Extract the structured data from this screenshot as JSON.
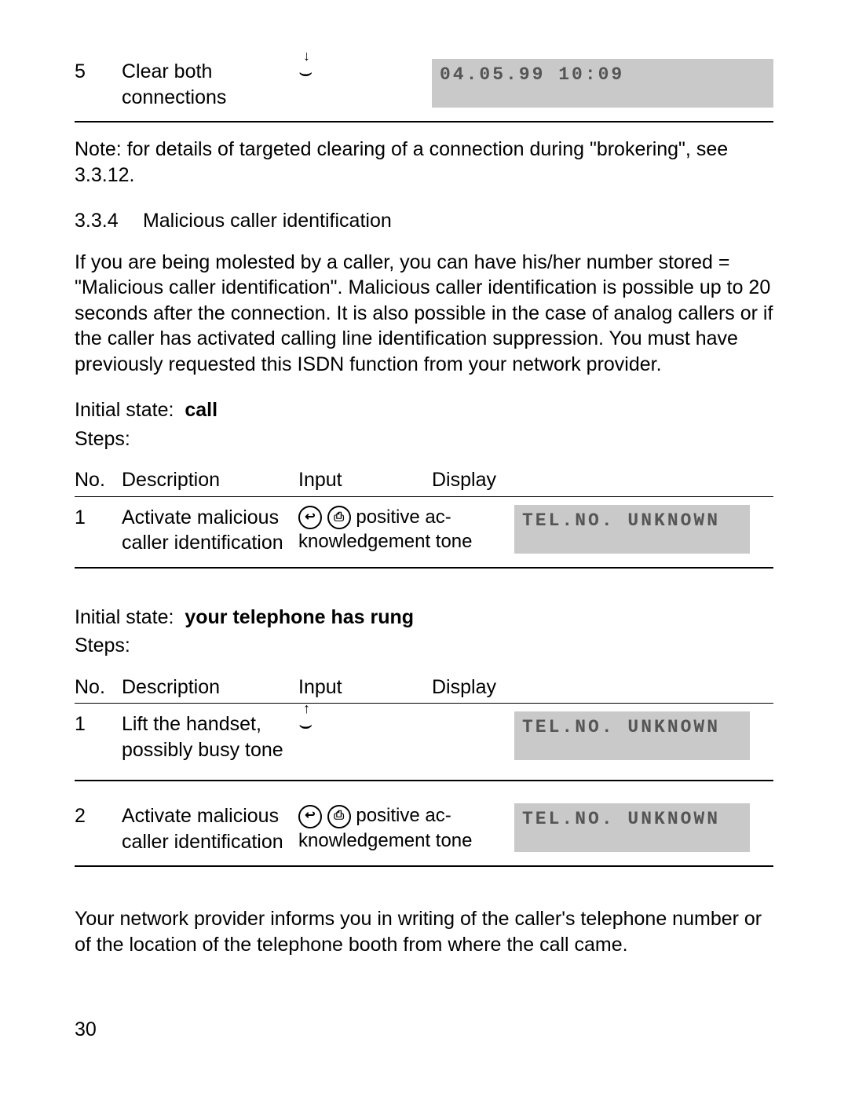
{
  "top_step": {
    "no": "5",
    "desc": "Clear both connections",
    "display": "04.05.99  10:09"
  },
  "note": "Note: for details of targeted clearing of a connection during \"brokering\", see 3.3.12.",
  "section": {
    "number": "3.3.4",
    "title": "Malicious caller identification"
  },
  "intro": "If you are being molested by a caller, you can have his/her number stored = \"Malicious caller identification\". Malicious caller identification is possible up to 20 seconds after the connection. It is also possible in the case of analog callers or if the caller has activated calling line identification suppression. You must have previously requested this ISDN function from your network provider.",
  "labels": {
    "initial_state": "Initial state:",
    "steps": "Steps:",
    "no": "No.",
    "description": "Description",
    "input": "Input",
    "display": "Display"
  },
  "block1": {
    "state": "call",
    "rows": [
      {
        "no": "1",
        "desc": "Activate malicious caller identification",
        "input_after": " positive ac-\nknowledgement tone",
        "display": "TEL.NO. UNKNOWN"
      }
    ]
  },
  "block2": {
    "state": "your telephone has rung",
    "rows": [
      {
        "no": "1",
        "desc": "Lift the handset, possibly busy tone",
        "display": "TEL.NO. UNKNOWN"
      },
      {
        "no": "2",
        "desc": "Activate malicious caller identification",
        "input_after": " positive ac-\nknowledgement tone",
        "display": "TEL.NO. UNKNOWN"
      }
    ]
  },
  "footer_para": "Your network provider informs you in writing of the caller's telephone number or of the location of the telephone booth from where the call came.",
  "page_number": "30"
}
